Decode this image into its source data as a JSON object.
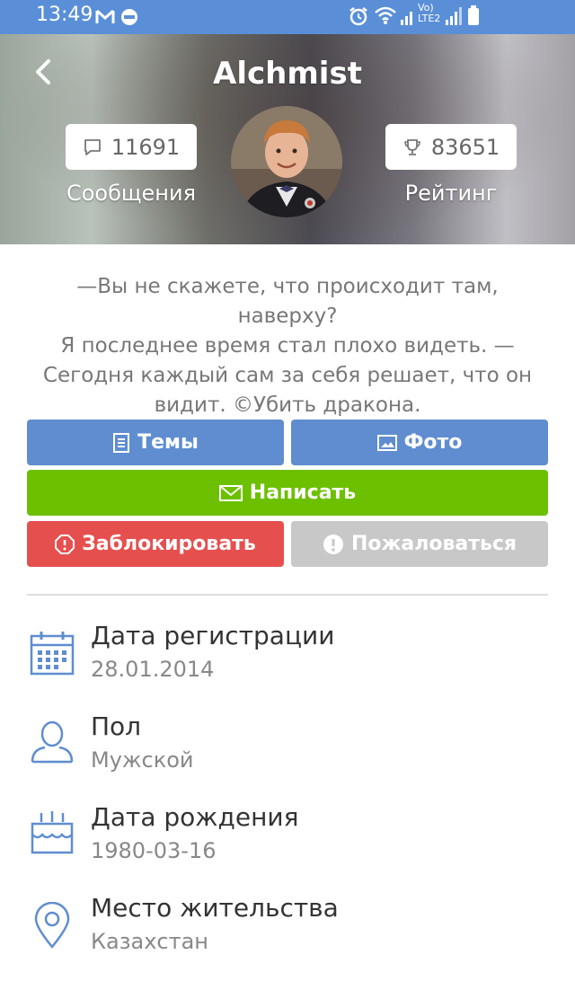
{
  "status_bar": {
    "time": "13:49",
    "network": "Vo) LTE2"
  },
  "header": {
    "title": "Alchmist",
    "messages": {
      "count": "11691",
      "label": "Сообщения"
    },
    "rating": {
      "count": "83651",
      "label": "Рейтинг"
    }
  },
  "quote": {
    "lines": [
      "—Вы не скажете, что происходит там, наверху?",
      "Я последнее время стал плохо видеть.  —",
      "Сегодня каждый сам за себя решает, что он",
      "видит. ©Убить дракона."
    ]
  },
  "buttons": {
    "topics": "Темы",
    "photo": "Фото",
    "write": "Написать",
    "block": "Заблокировать",
    "report": "Пожаловаться"
  },
  "info": [
    {
      "title": "Дата регистрации",
      "value": "28.01.2014",
      "icon": "calendar-icon"
    },
    {
      "title": "Пол",
      "value": "Мужской",
      "icon": "user-icon"
    },
    {
      "title": "Дата рождения",
      "value": "1980-03-16",
      "icon": "birthday-cake-icon"
    },
    {
      "title": "Место жительства",
      "value": "Казахстан",
      "icon": "location-pin-icon"
    }
  ],
  "colors": {
    "status_bar": "#5a8fd8",
    "button_blue": "#5f8dd0",
    "button_green": "#6cc000",
    "button_red": "#e5504f",
    "button_gray": "#c8c8c8",
    "icon_blue": "#5f8dd0"
  }
}
